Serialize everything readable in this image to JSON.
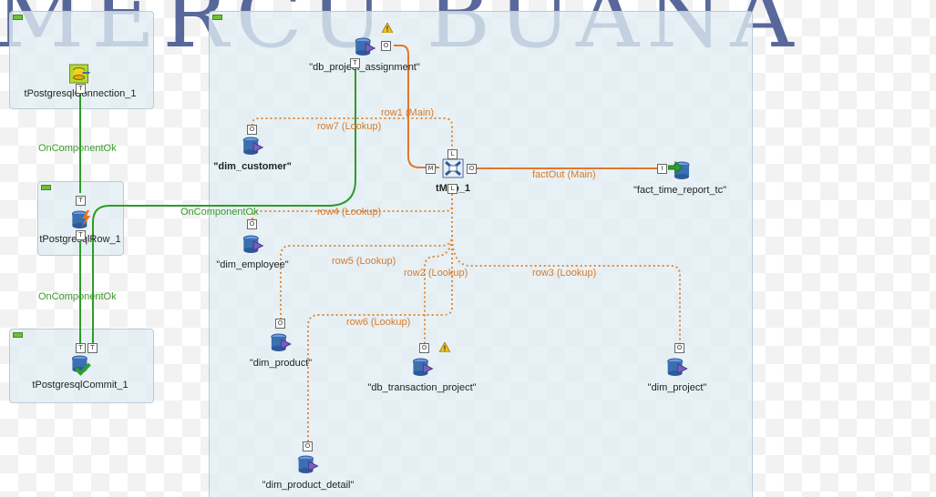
{
  "watermark": "MERCU BUANA",
  "colors": {
    "lookup": "#e08a3a",
    "main": "#e0782a",
    "trigger": "#2f9a2a",
    "db": "#3a6fb0"
  },
  "components": {
    "connection": "tPostgresqlConnection_1",
    "row": "tPostgresqlRow_1",
    "commit": "tPostgresqlCommit_1",
    "project_assignment": "\"db_project_assignment\"",
    "customer": "\"dim_customer\"",
    "employee": "\"dim_employee\"",
    "product": "\"dim_product\"",
    "transaction_project": "\"db_transaction_project\"",
    "project": "\"dim_project\"",
    "product_detail": "\"dim_product_detail\"",
    "tmap": "tMap_1",
    "fact": "\"fact_time_report_tc\""
  },
  "connections": {
    "ok1": "OnComponentOk",
    "ok2": "OnComponentOk",
    "ok3": "OnComponentOk",
    "row1": "row1 (Main)",
    "row7": "row7 (Lookup)",
    "row4": "row4 (Lookup)",
    "row5": "row5 (Lookup)",
    "row2": "row2 (Lookup)",
    "row3": "row3 (Lookup)",
    "row6": "row6 (Lookup)",
    "fact_out": "factOut (Main)"
  }
}
